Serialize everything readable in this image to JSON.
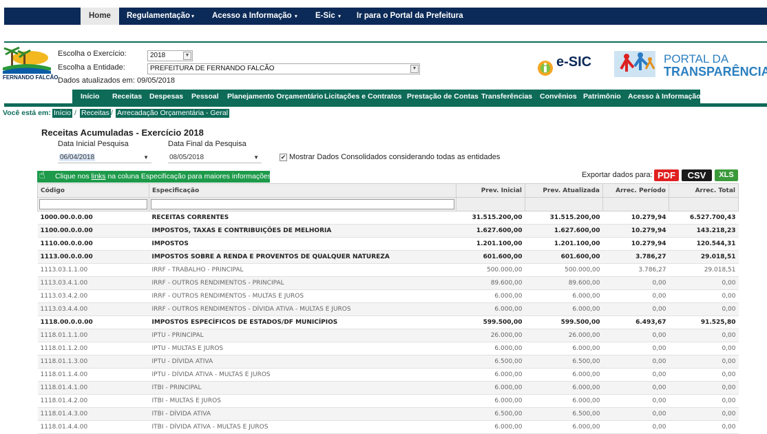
{
  "topnav": {
    "items": [
      "Home",
      "Regulamentação",
      "Acesso a Informação",
      "E-Sic",
      "Ir para o Portal da Prefeitura"
    ]
  },
  "header": {
    "exercicio_label": "Escolha o Exercício:",
    "exercicio_value": "2018",
    "entidade_label": "Escolha a Entidade:",
    "entidade_value": "PREFEITURA DE FERNANDO FALCÃO",
    "updated": "Dados atualizados em: 09/05/2018",
    "logo_name": "FERNANDO FALCÃO",
    "esic_text": "e-SIC",
    "portal_line1": "PORTAL DA",
    "portal_line2": "TRANSPARÊNCIA"
  },
  "menu": {
    "items": [
      "Início",
      "Receitas",
      "Despesas",
      "Pessoal",
      "Planejamento Orçamentário",
      "Licitações e Contratos",
      "Prestação de Contas",
      "Transferências",
      "Convênios",
      "Patrimônio",
      "Acesso à Informação"
    ]
  },
  "breadcrumb": {
    "label": "Você está em:",
    "items": [
      "Início",
      "Receitas",
      "Arrecadação Orçamentária - Geral"
    ]
  },
  "content": {
    "title": "Receitas Acumuladas - Exercício 2018",
    "data_inicial_label": "Data Inicial Pesquisa",
    "data_inicial_value": "06/04/2018",
    "data_final_label": "Data Final da Pesquisa",
    "data_final_value": "08/05/2018",
    "consolidado_label": "Mostrar Dados Consolidados considerando todas as entidades",
    "info_pre": "Clique nos ",
    "info_link": "links",
    "info_post": " na coluna Especificação para maiores informações.",
    "export_label": "Exportar dados para:",
    "export_pdf": "PDF",
    "export_csv": "CSV",
    "export_xls": "XLS"
  },
  "colors": {
    "navy": "#0b2a57",
    "green": "#0d6b58",
    "banner_green": "#1d9a4a",
    "pdf_red": "#e02020",
    "xls_green": "#3a9a3a"
  },
  "table": {
    "headers": [
      "Código",
      "Especificação",
      "Prev. Inicial",
      "Prev. Atualizada",
      "Arrec. Período",
      "Arrec. Total"
    ],
    "rows": [
      {
        "bold": true,
        "cells": [
          "1000.00.0.0.00",
          "RECEITAS CORRENTES",
          "31.515.200,00",
          "31.515.200,00",
          "10.279,94",
          "6.527.700,43"
        ]
      },
      {
        "bold": true,
        "cells": [
          "1100.00.0.0.00",
          "IMPOSTOS, TAXAS E CONTRIBUIÇÕES DE MELHORIA",
          "1.627.600,00",
          "1.627.600,00",
          "10.279,94",
          "143.218,23"
        ]
      },
      {
        "bold": true,
        "cells": [
          "1110.00.0.0.00",
          "IMPOSTOS",
          "1.201.100,00",
          "1.201.100,00",
          "10.279,94",
          "120.544,31"
        ]
      },
      {
        "bold": true,
        "cells": [
          "1113.00.0.0.00",
          "IMPOSTOS SOBRE A RENDA E PROVENTOS DE QUALQUER NATUREZA",
          "601.600,00",
          "601.600,00",
          "3.786,27",
          "29.018,51"
        ]
      },
      {
        "bold": false,
        "cells": [
          "1113.03.1.1.00",
          "IRRF - TRABALHO - PRINCIPAL",
          "500.000,00",
          "500.000,00",
          "3.786,27",
          "29.018,51"
        ]
      },
      {
        "bold": false,
        "cells": [
          "1113.03.4.1.00",
          "IRRF - OUTROS RENDIMENTOS - PRINCIPAL",
          "89.600,00",
          "89.600,00",
          "0,00",
          "0,00"
        ]
      },
      {
        "bold": false,
        "cells": [
          "1113.03.4.2.00",
          "IRRF - OUTROS RENDIMENTOS - MULTAS E JUROS",
          "6.000,00",
          "6.000,00",
          "0,00",
          "0,00"
        ]
      },
      {
        "bold": false,
        "cells": [
          "1113.03.4.4.00",
          "IRRF - OUTROS RENDIMENTOS - DÍVIDA ATIVA - MULTAS E JUROS",
          "6.000,00",
          "6.000,00",
          "0,00",
          "0,00"
        ]
      },
      {
        "bold": true,
        "cells": [
          "1118.00.0.0.00",
          "IMPOSTOS ESPECÍFICOS DE ESTADOS/DF MUNICÍPIOS",
          "599.500,00",
          "599.500,00",
          "6.493,67",
          "91.525,80"
        ]
      },
      {
        "bold": false,
        "cells": [
          "1118.01.1.1.00",
          "IPTU - PRINCIPAL",
          "26.000,00",
          "26.000,00",
          "0,00",
          "0,00"
        ]
      },
      {
        "bold": false,
        "cells": [
          "1118.01.1.2.00",
          "IPTU - MULTAS E JUROS",
          "6.000,00",
          "6.000,00",
          "0,00",
          "0,00"
        ]
      },
      {
        "bold": false,
        "cells": [
          "1118.01.1.3.00",
          "IPTU - DÍVIDA ATIVA",
          "6.500,00",
          "6.500,00",
          "0,00",
          "0,00"
        ]
      },
      {
        "bold": false,
        "cells": [
          "1118.01.1.4.00",
          "IPTU - DÍVIDA ATIVA - MULTAS E JUROS",
          "6.000,00",
          "6.000,00",
          "0,00",
          "0,00"
        ]
      },
      {
        "bold": false,
        "cells": [
          "1118.01.4.1.00",
          "ITBI - PRINCIPAL",
          "6.000,00",
          "6.000,00",
          "0,00",
          "0,00"
        ]
      },
      {
        "bold": false,
        "cells": [
          "1118.01.4.2.00",
          "ITBI - MULTAS E JUROS",
          "6.000,00",
          "6.000,00",
          "0,00",
          "0,00"
        ]
      },
      {
        "bold": false,
        "cells": [
          "1118.01.4.3.00",
          "ITBI - DÍVIDA ATIVA",
          "6.500,00",
          "6.500,00",
          "0,00",
          "0,00"
        ]
      },
      {
        "bold": false,
        "cells": [
          "1118.01.4.4.00",
          "ITBI - DÍVIDA ATIVA - MULTAS E JUROS",
          "6.000,00",
          "6.000,00",
          "0,00",
          "0,00"
        ]
      }
    ]
  }
}
